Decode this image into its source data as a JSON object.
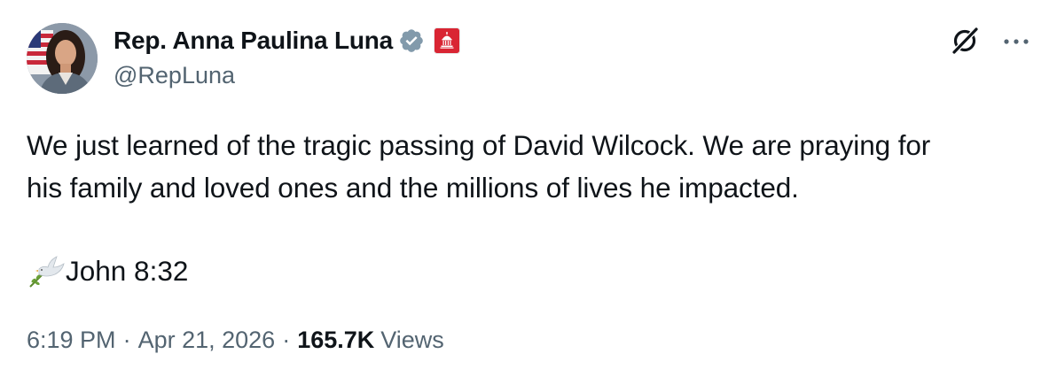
{
  "author": {
    "display_name": "Rep. Anna Paulina Luna",
    "handle": "@RepLuna"
  },
  "badges": {
    "verified_icon": "verified-badge-icon",
    "affiliation_icon": "us-capitol-affiliation-icon",
    "verified_color": "#829aab",
    "affiliation_color": "#d92533"
  },
  "tweet": {
    "line1": "We just learned of the tragic passing of David Wilcock. We are praying for",
    "line2": "his family and loved ones and the millions of lives he impacted.",
    "verse": "John 8:32",
    "verse_emoji": "dove-icon"
  },
  "meta": {
    "time": "6:19 PM",
    "separator": "·",
    "date": "Apr 21, 2026",
    "views_count": "165.7K",
    "views_label": "Views"
  },
  "actions": {
    "grok_icon": "grok-icon",
    "more_icon": "more-options-icon"
  }
}
